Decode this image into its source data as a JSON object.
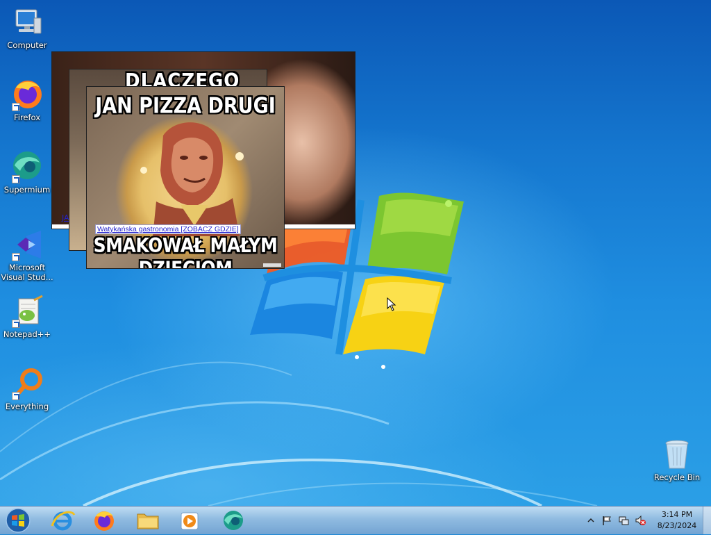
{
  "desktop": {
    "icons": [
      {
        "label": "Computer",
        "icon": "computer-icon"
      },
      {
        "label": "Firefox",
        "icon": "firefox-icon"
      },
      {
        "label": "Supermium",
        "icon": "supermium-icon"
      },
      {
        "label": "Microsoft Visual Stud...",
        "icon": "visual-studio-icon"
      },
      {
        "label": "Notepad++",
        "icon": "notepad-plus-plus-icon"
      },
      {
        "label": "Everything",
        "icon": "everything-search-icon"
      },
      {
        "label": "Recycle Bin",
        "icon": "recycle-bin-icon"
      }
    ]
  },
  "popups": {
    "back": {
      "link_stub": "JA"
    },
    "middle": {
      "headline_fragment": "DLACZEGO"
    },
    "front": {
      "top_text": "JAN PIZZA DRUGI",
      "bottom_text": "SMAKOWAŁ MAŁYM DZIECIOM",
      "link_text": "Watykańska gastronomia [ZOBACZ GDZIE]"
    }
  },
  "taskbar": {
    "start_icon": "windows-start-icon",
    "pinned": [
      {
        "name": "Internet Explorer",
        "icon": "internet-explorer-icon"
      },
      {
        "name": "Firefox",
        "icon": "firefox-icon"
      },
      {
        "name": "Windows Explorer",
        "icon": "folder-icon"
      },
      {
        "name": "Windows Media Player",
        "icon": "media-player-icon"
      },
      {
        "name": "Supermium",
        "icon": "supermium-icon"
      }
    ],
    "tray": {
      "icons": [
        "show-hidden-icons-chevron",
        "action-center-flag-icon",
        "network-icon",
        "volume-muted-icon"
      ],
      "time": "3:14 PM",
      "date": "8/23/2024"
    }
  },
  "colors": {
    "wallpaper_top": "#0b58b6",
    "wallpaper_bottom": "#2b9fe6",
    "link_blue": "#2222cc"
  }
}
